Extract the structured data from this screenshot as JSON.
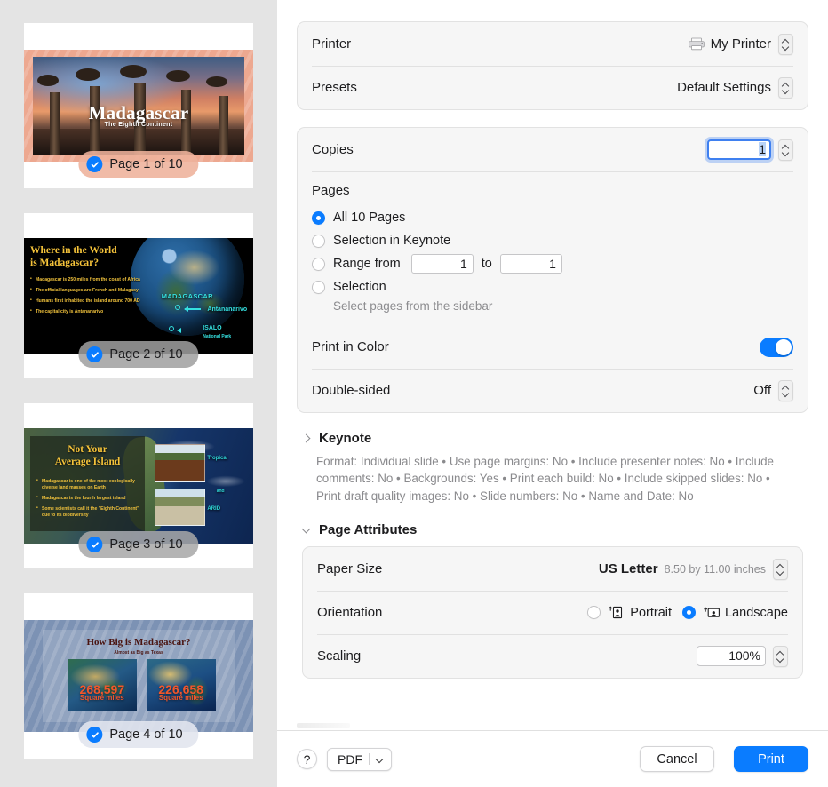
{
  "sidebar": {
    "pages": [
      {
        "badge": "Page 1 of 10",
        "selected": true,
        "slide": {
          "title": "Madagascar",
          "subtitle": "The Eighth Continent"
        }
      },
      {
        "badge": "Page 2 of 10",
        "selected": true,
        "slide": {
          "title_line1": "Where in the World",
          "title_line2": "is Madagascar?",
          "bullets": [
            "Madagascar is 250 miles from the coast of Africa",
            "The official languages are French and Malagasy",
            "Humans first inhabited the island around 700 AD",
            "The capital city is Antananarivo"
          ],
          "labels": [
            "MADAGASCAR",
            "Antananarivo",
            "ISALO",
            "National Park"
          ]
        }
      },
      {
        "badge": "Page 3 of 10",
        "selected": true,
        "slide": {
          "title_line1": "Not Your",
          "title_line2": "Average Island",
          "bullets": [
            "Madagascar is one of the most ecologically diverse land masses on Earth",
            "Madagascar is the fourth largest island",
            "Some scientists call it the \"Eighth Continent\" due to its biodiversity"
          ],
          "labels": [
            "Tropical",
            "and",
            "ARID"
          ]
        }
      },
      {
        "badge": "Page 4 of 10",
        "selected": true,
        "slide": {
          "title": "How Big is Madagascar?",
          "subtitle": "Almost as Big as Texas",
          "stat1_value": "268,597",
          "stat1_unit": "Square miles",
          "stat2_value": "226,658",
          "stat2_unit": "Square miles"
        }
      }
    ]
  },
  "printer_group": {
    "printer_label": "Printer",
    "printer_value": "My Printer",
    "printer_icon": "printer-icon",
    "presets_label": "Presets",
    "presets_value": "Default Settings"
  },
  "copies_group": {
    "copies_label": "Copies",
    "copies_value": "1",
    "pages_label": "Pages",
    "options": [
      {
        "label": "All 10 Pages",
        "selected": true
      },
      {
        "label": "Selection in Keynote",
        "selected": false
      },
      {
        "label": "Range from",
        "selected": false
      },
      {
        "label": "Selection",
        "selected": false
      }
    ],
    "range_to_label": "to",
    "range_from_value": "1",
    "range_to_value": "1",
    "selection_hint": "Select pages from the sidebar",
    "print_in_color_label": "Print in Color",
    "print_in_color_state": "on",
    "double_sided_label": "Double-sided",
    "double_sided_value": "Off"
  },
  "keynote_section": {
    "title": "Keynote",
    "expanded": false,
    "summary": "Format: Individual slide • Use page margins: No • Include presenter notes: No • Include comments: No • Backgrounds: Yes • Print each build: No • Include skipped slides: No • Print draft quality images: No • Slide numbers: No • Name and Date: No"
  },
  "page_attributes": {
    "title": "Page Attributes",
    "expanded": true,
    "paper_size_label": "Paper Size",
    "paper_size_value": "US Letter",
    "paper_size_dimensions": "8.50 by 11.00 inches",
    "orientation_label": "Orientation",
    "orientation_portrait": "Portrait",
    "orientation_landscape": "Landscape",
    "orientation_selected": "Landscape",
    "scaling_label": "Scaling",
    "scaling_value": "100%"
  },
  "footer": {
    "help_label": "?",
    "pdf_label": "PDF",
    "cancel_label": "Cancel",
    "print_label": "Print"
  },
  "colors": {
    "accent": "#0a7cff",
    "panel_bg": "#ffffff",
    "group_bg": "#f6f6f6",
    "sidebar_bg": "#e4e4e4",
    "secondary_text": "#8a8a8d"
  }
}
